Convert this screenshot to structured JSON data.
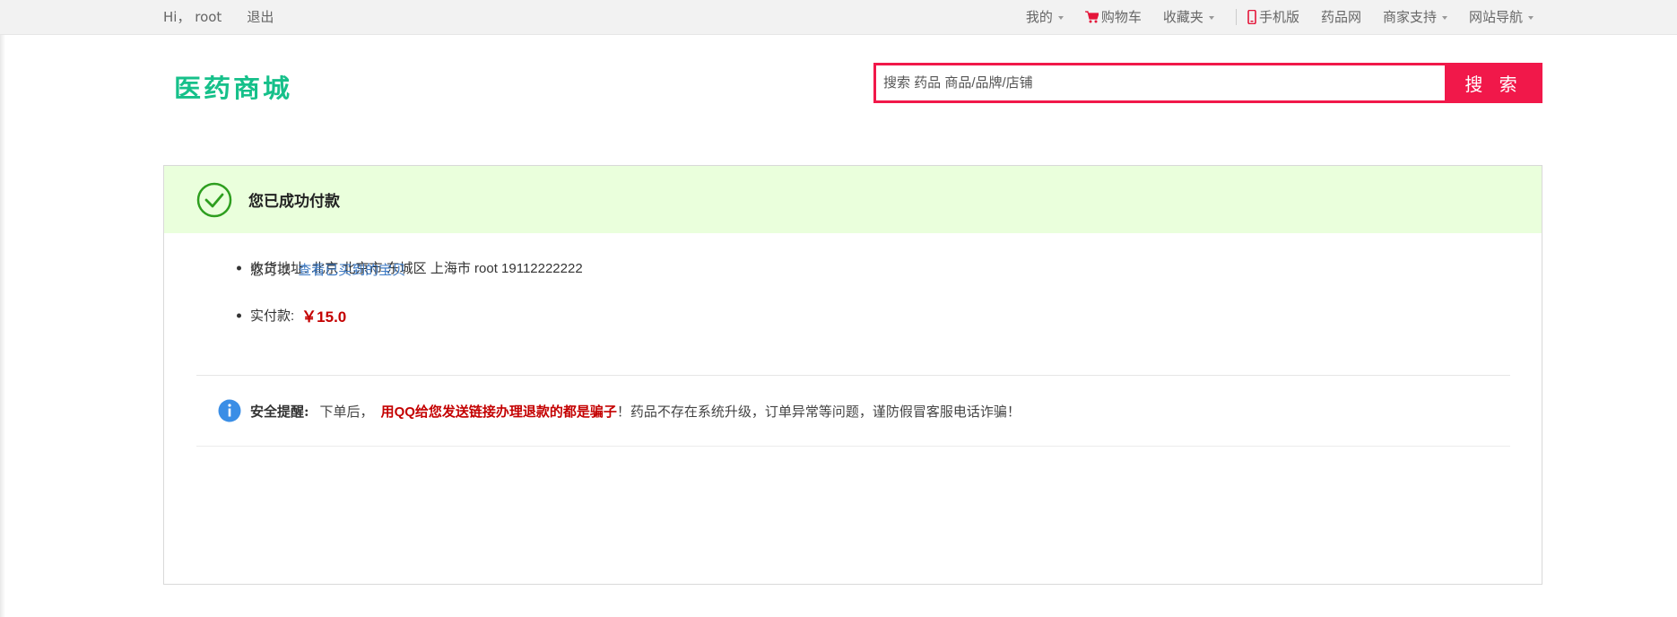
{
  "topbar": {
    "greeting": "Hi，",
    "username": "root",
    "logout": "退出",
    "my": "我的",
    "cart": "购物车",
    "favorites": "收藏夹",
    "mobile": "手机版",
    "drug_site": "药品网",
    "merchant_support": "商家支持",
    "site_nav": "网站导航"
  },
  "header": {
    "logo_text": "医药商城",
    "search_placeholder": "搜索 药品 商品/品牌/店铺",
    "search_button": "搜 索"
  },
  "success": {
    "title": "您已成功付款",
    "address_label": "收货地址:",
    "address_value": "北京 北京市 东城区 上海市 root 19112222222",
    "paid_label": "实付款:",
    "paid_amount": "￥15.0",
    "view_prefix": "您可以",
    "view_link": "查看已买到的宝贝"
  },
  "safety": {
    "label": "安全提醒:",
    "prefix": "下单后，",
    "warning": "用QQ给您发送链接办理退款的都是骗子",
    "suffix": "！药品不存在系统升级，订单异常等问题，谨防假冒客服电话诈骗！"
  },
  "colors": {
    "brand_green": "#16c08a",
    "search_red": "#f1184a",
    "price_red": "#c40000",
    "success_bg": "#eaffdc",
    "link_blue": "#3b79c4"
  },
  "icons": {
    "cart": "cart-icon",
    "mobile": "phone-icon",
    "success": "check-circle-icon",
    "info": "info-icon"
  }
}
